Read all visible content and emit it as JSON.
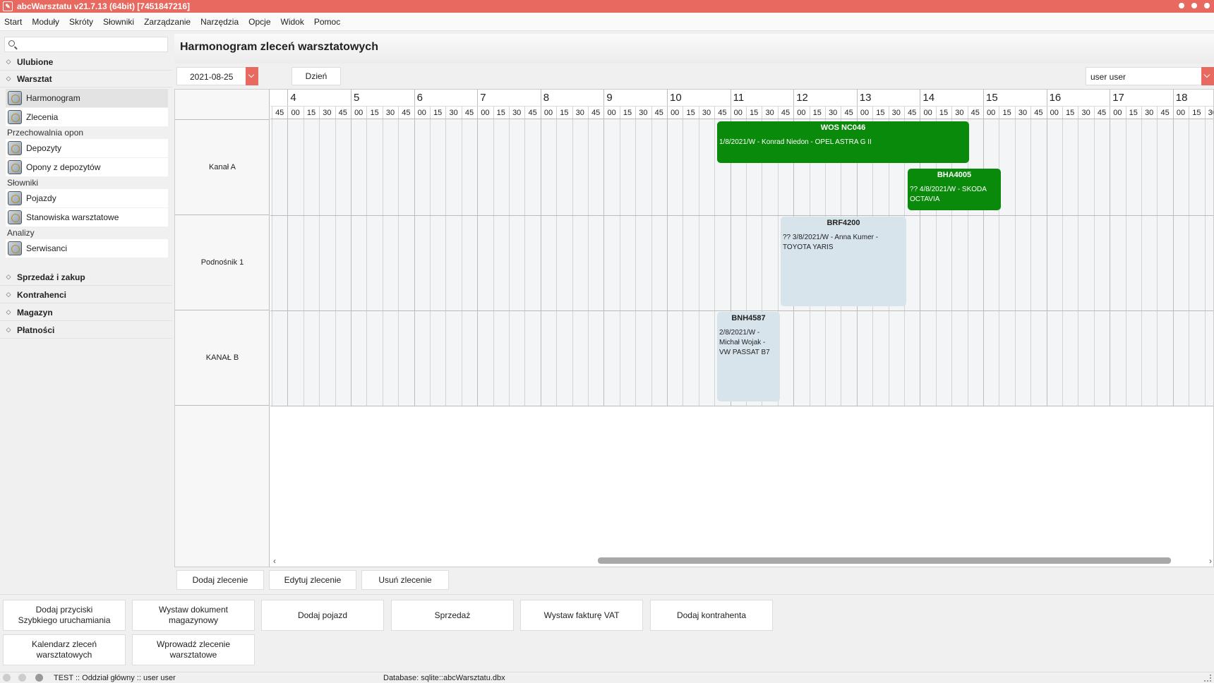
{
  "window": {
    "title": "abcWarsztatu v21.7.13 (64bit) [7451847216]"
  },
  "menu": [
    "Start",
    "Moduły",
    "Skróty",
    "Słowniki",
    "Zarządzanie",
    "Narzędzia",
    "Opcje",
    "Widok",
    "Pomoc"
  ],
  "sidebar": {
    "search_placeholder": "",
    "sections": {
      "favorites": "Ulubione",
      "workshop": "Warsztat",
      "sales": "Sprzedaż i zakup",
      "contractors": "Kontrahenci",
      "warehouse": "Magazyn",
      "payments": "Płatności"
    },
    "groups": {
      "tire_storage": "Przechowalnia opon",
      "dictionaries": "Słowniki",
      "analyses": "Analizy"
    },
    "items": {
      "schedule": "Harmonogram",
      "orders": "Zlecenia",
      "deposits": "Depozyty",
      "tires_from_deposits": "Opony z depozytów",
      "vehicles": "Pojazdy",
      "workstations": "Stanowiska warsztatowe",
      "servicemen": "Serwisanci"
    }
  },
  "main": {
    "title": "Harmonogram zleceń warsztatowych",
    "date": "2021-08-25",
    "view_button": "Dzień",
    "user": "user user"
  },
  "scheduler": {
    "hours": [
      "4",
      "5",
      "6",
      "7",
      "8",
      "9",
      "10",
      "11",
      "12",
      "13",
      "14",
      "15",
      "16",
      "17",
      "18"
    ],
    "minute_labels": [
      "00",
      "15",
      "30",
      "45"
    ],
    "leading_minute": "45",
    "rows": [
      "Kanał A",
      "Podnośnik 1",
      "KANAŁ B"
    ],
    "events": [
      {
        "plate": "WOS NC046",
        "desc": "1/8/2021/W - Konrad Niedon - OPEL ASTRA G II",
        "color": "#0a8a0a"
      },
      {
        "plate": "BHA4005",
        "desc": "?? 4/8/2021/W - SKODA OCTAVIA",
        "color": "#0a8a0a"
      },
      {
        "plate": "BRF4200",
        "desc": "?? 3/8/2021/W - Anna Kumer - TOYOTA YARIS",
        "color": "#d8e4ec"
      },
      {
        "plate": "BNH4587",
        "desc": "2/8/2021/W - Michał Wojak - VW PASSAT B7",
        "color": "#d8e4ec"
      }
    ]
  },
  "actions": {
    "add": "Dodaj zlecenie",
    "edit": "Edytuj zlecenie",
    "delete": "Usuń zlecenie"
  },
  "quick_buttons": {
    "add_quick": "Dodaj przyciski\nSzybkiego uruchamiania",
    "warehouse_doc": "Wystaw dokument\nmagazynowy",
    "add_vehicle": "Dodaj pojazd",
    "sale": "Sprzedaż",
    "vat_invoice": "Wystaw fakturę VAT",
    "add_contractor": "Dodaj kontrahenta",
    "orders_calendar": "Kalendarz zleceń\nwarsztatowych",
    "enter_order": "Wprowadź zlecenie\nwarsztatowe"
  },
  "status": {
    "left": "TEST :: Oddział główny :: user user",
    "db": "Database: sqlite::abcWarsztatu.dbx"
  }
}
